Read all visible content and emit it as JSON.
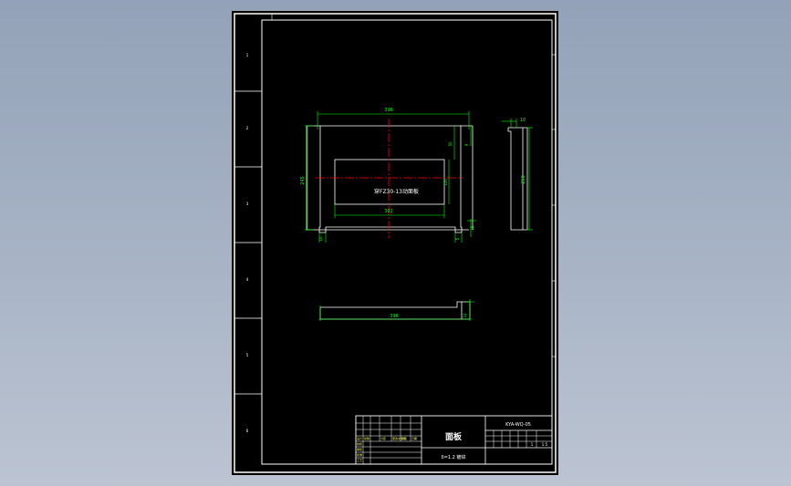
{
  "drawing": {
    "title": "面板",
    "drawing_number": "KYA-WQ-05",
    "material": "δ=1.2 镀锌",
    "scale": "1:5",
    "sheet_info": "1"
  },
  "front_view": {
    "overall_width_dim": "396",
    "overall_height_dim": "245",
    "inner_width_dim": "302",
    "top_offset_dim": "50",
    "right_offset_dim": "9",
    "inner_height_dim": "120",
    "bottom_right_dim": "15",
    "bottom_left_dim": "10",
    "bottom_right2_dim": "5",
    "cutout_label": "穿FZ30-13动面板"
  },
  "side_view": {
    "thickness_dim": "10",
    "height_dim": "250"
  },
  "bottom_view": {
    "length_dim": "396",
    "flange_dim": "10"
  },
  "title_block_labels": [
    "设计",
    "校核",
    "审核",
    "批准",
    "工艺",
    "标记",
    "处数",
    "分区",
    "更改文件号",
    "签名",
    "日期"
  ],
  "colors": {
    "background": "#000000",
    "frame": "#ffffff",
    "dimension": "#00ff00",
    "centerline": "#ff0000",
    "text_main": "#ffffff"
  }
}
